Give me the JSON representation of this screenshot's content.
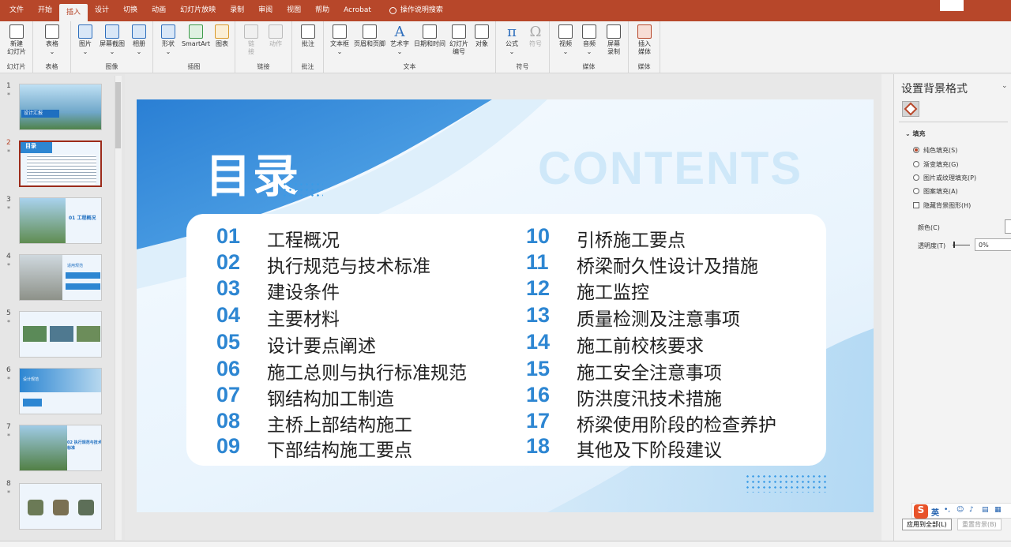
{
  "tabs": [
    "文件",
    "开始",
    "插入",
    "设计",
    "切换",
    "动画",
    "幻灯片放映",
    "录制",
    "审阅",
    "视图",
    "帮助",
    "Acrobat"
  ],
  "active_tab": "插入",
  "tell_me": "操作说明搜索",
  "ribbon": {
    "new_slide": [
      "新建",
      "幻灯片"
    ],
    "table": "表格",
    "picture": "图片",
    "screenshot": "屏幕截图",
    "album": "相册",
    "shapes": "形状",
    "smartart": "SmartArt",
    "chart": "图表",
    "link": [
      "链",
      "接"
    ],
    "action": "动作",
    "comment": "批注",
    "textbox": "文本框",
    "header_footer": "页眉和页脚",
    "wordart": "艺术字",
    "datetime": "日期和时间",
    "slide_number": [
      "幻灯片",
      "编号"
    ],
    "object": "对象",
    "equation": "公式",
    "symbol": "符号",
    "video": "视频",
    "audio": "音频",
    "screen_record": [
      "屏幕",
      "录制"
    ],
    "insert_media": [
      "插入",
      "媒体"
    ],
    "groups": {
      "slides": "幻灯片",
      "tables": "表格",
      "images": "图像",
      "illustrations": "插图",
      "links": "链接",
      "comments": "批注",
      "text": "文本",
      "symbols": "符号",
      "media": "媒体",
      "media2": "媒体"
    }
  },
  "thumbnails": [
    {
      "n": "1",
      "caption": "设计汇报"
    },
    {
      "n": "2",
      "caption": "目录"
    },
    {
      "n": "3",
      "caption": "01 工程概况"
    },
    {
      "n": "4",
      "caption": "适用规范"
    },
    {
      "n": "5",
      "caption": ""
    },
    {
      "n": "6",
      "caption": "设计规范"
    },
    {
      "n": "7",
      "caption": "02 执行规范与技术标准"
    },
    {
      "n": "8",
      "caption": ""
    }
  ],
  "slide": {
    "title": "目录",
    "watermark": "CONTENTS",
    "left_items": [
      {
        "num": "01",
        "text": "工程概况"
      },
      {
        "num": "02",
        "text": "执行规范与技术标准"
      },
      {
        "num": "03",
        "text": "建设条件"
      },
      {
        "num": "04",
        "text": "主要材料"
      },
      {
        "num": "05",
        "text": "设计要点阐述"
      },
      {
        "num": "06",
        "text": "施工总则与执行标准规范"
      },
      {
        "num": "07",
        "text": "钢结构加工制造"
      },
      {
        "num": "08",
        "text": "主桥上部结构施工"
      },
      {
        "num": "09",
        "text": "下部结构施工要点"
      }
    ],
    "right_items": [
      {
        "num": "10",
        "text": "引桥施工要点"
      },
      {
        "num": "11",
        "text": "桥梁耐久性设计及措施"
      },
      {
        "num": "12",
        "text": "施工监控"
      },
      {
        "num": "13",
        "text": "质量检测及注意事项"
      },
      {
        "num": "14",
        "text": "施工前校核要求"
      },
      {
        "num": "15",
        "text": "施工安全注意事项"
      },
      {
        "num": "16",
        "text": "防洪度汛技术措施"
      },
      {
        "num": "17",
        "text": "桥梁使用阶段的检查养护"
      },
      {
        "num": "18",
        "text": "其他及下阶段建议"
      }
    ]
  },
  "format_pane": {
    "title": "设置背景格式",
    "section": "填充",
    "options": [
      "纯色填充(S)",
      "渐变填充(G)",
      "图片或纹理填充(P)",
      "图案填充(A)"
    ],
    "selected_option": "纯色填充(S)",
    "hide_graphics": "隐藏背景图形(H)",
    "color_label": "颜色(C)",
    "transparency_label": "透明度(T)",
    "transparency_value": "0%",
    "apply_all": "应用到全部(L)",
    "reset": "重置背景(B)"
  },
  "ime": {
    "lang": "英"
  },
  "colors": {
    "accent": "#b7472a",
    "slide_blue": "#2d86d2"
  }
}
